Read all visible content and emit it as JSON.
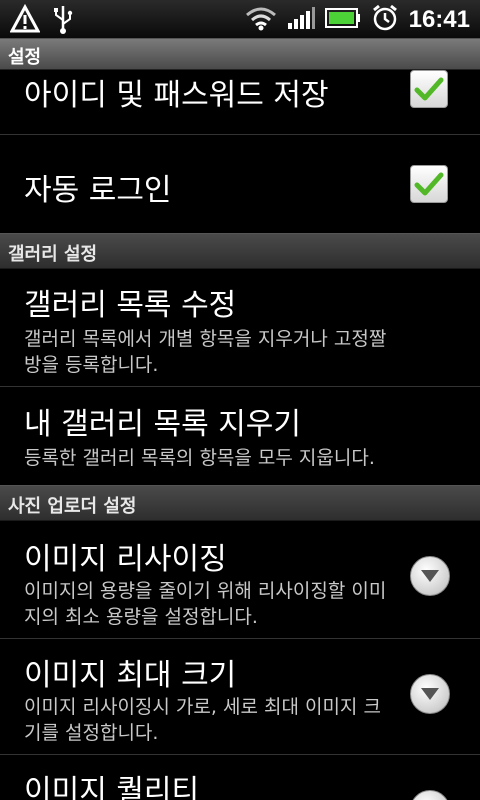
{
  "status_bar": {
    "time": "16:41",
    "icons": [
      "warning-icon",
      "usb-icon",
      "wifi-icon",
      "signal-icon",
      "battery-icon",
      "alarm-icon"
    ]
  },
  "title_bar": {
    "title": "설정"
  },
  "list": {
    "rows_top": [
      {
        "title": "아이디 및 패스워드 저장",
        "checked": true
      },
      {
        "title": "자동 로그인",
        "checked": true
      }
    ],
    "gallery_section": {
      "header": "갤러리 설정",
      "items": [
        {
          "title": "갤러리 목록 수정",
          "summary": "갤러리 목록에서 개별 항목을 지우거나 고정짤방을 등록합니다."
        },
        {
          "title": "내 갤러리 목록 지우기",
          "summary": "등록한 갤러리 목록의 항목을 모두 지웁니다."
        }
      ]
    },
    "uploader_section": {
      "header": "사진 업로더 설정",
      "items": [
        {
          "title": "이미지 리사이징",
          "summary": "이미지의 용량을 줄이기 위해 리사이징할 이미지의 최소 용량을 설정합니다."
        },
        {
          "title": "이미지 최대 크기",
          "summary": "이미지 리사이징시 가로, 세로 최대 이미지 크기를 설정합니다."
        },
        {
          "title": "이미지 퀄리티",
          "summary": ""
        }
      ]
    }
  },
  "colors": {
    "checkmark": "#52b828",
    "background": "#000000"
  }
}
